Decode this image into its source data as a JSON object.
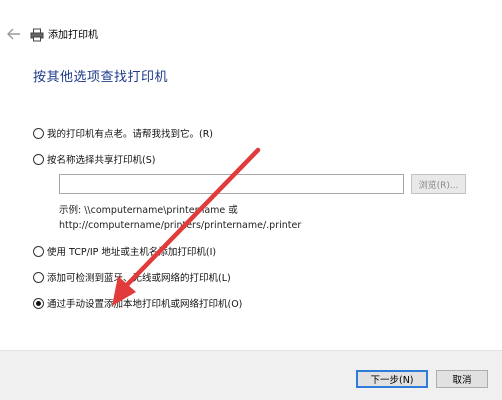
{
  "window": {
    "title": "添加打印机"
  },
  "heading": "按其他选项查找打印机",
  "options": [
    {
      "label": "我的打印机有点老。请帮我找到它。(R)",
      "checked": false
    },
    {
      "label": "按名称选择共享打印机(S)",
      "checked": false
    },
    {
      "label": "使用 TCP/IP 地址或主机名添加打印机(I)",
      "checked": false
    },
    {
      "label": "添加可检测到蓝牙、无线或网络的打印机(L)",
      "checked": false
    },
    {
      "label": "通过手动设置添加本地打印机或网络打印机(O)",
      "checked": true
    }
  ],
  "share": {
    "input_value": "",
    "browse_label": "浏览(R)...",
    "example_line1": "示例: \\\\computername\\printername 或",
    "example_line2": "http://computername/printers/printername/.printer"
  },
  "footer": {
    "next_label": "下一步(N)",
    "cancel_label": "取消"
  },
  "colors": {
    "heading": "#1e3a8a",
    "arrow": "#e23b3b",
    "primary_border": "#2f7bd9"
  },
  "icons": [
    "back-arrow-icon",
    "printer-icon"
  ]
}
